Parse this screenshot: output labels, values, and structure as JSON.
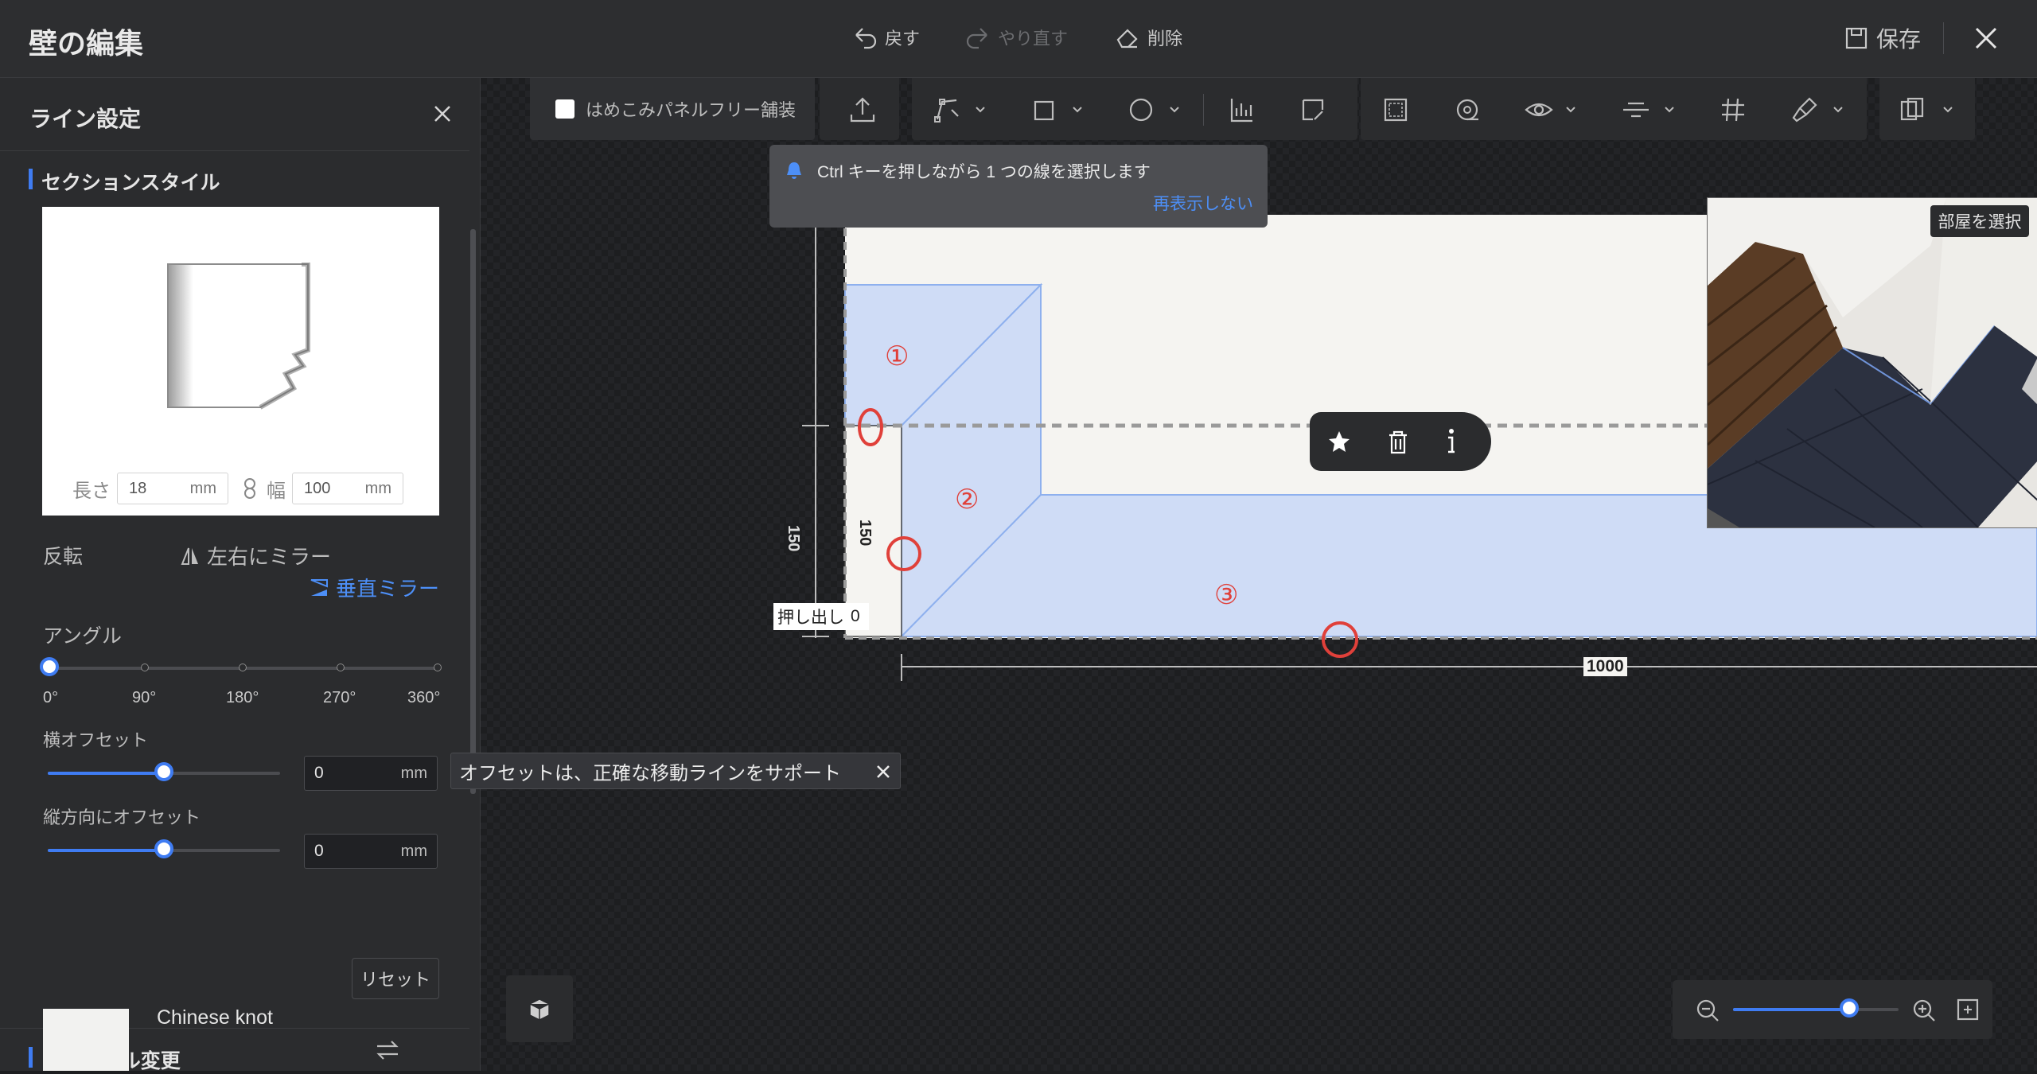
{
  "app": {
    "title": "壁の編集"
  },
  "top_actions": {
    "undo": "戻す",
    "redo": "やり直す",
    "delete": "削除",
    "save": "保存"
  },
  "panel": {
    "title": "ライン設定",
    "section_style": "セクションスタイル",
    "length_label": "長さ",
    "length_value": "18",
    "length_unit": "mm",
    "width_label": "幅",
    "width_value": "100",
    "width_unit": "mm",
    "flip_label": "反転",
    "mirror_h": "左右にミラー",
    "mirror_v": "垂直ミラー",
    "angle_label": "アングル",
    "angle_ticks": [
      "0°",
      "90°",
      "180°",
      "270°",
      "360°"
    ],
    "angle_value": 0,
    "h_offset_label": "横オフセット",
    "h_offset_value": "0",
    "h_offset_unit": "mm",
    "h_offset_level": 0.5,
    "v_offset_label": "縦方向にオフセット",
    "v_offset_value": "0",
    "v_offset_unit": "mm",
    "v_offset_level": 0.5,
    "reset": "リセット",
    "material_section": "マテリアル変更",
    "material_name": "Chinese knot"
  },
  "toolbar": {
    "seamless_label": "はめこみパネルフリー舗装",
    "seamless_checked": false
  },
  "notice": {
    "text": "Ctrl キーを押しながら 1 つの線を選択します",
    "link": "再表示しない"
  },
  "canvas": {
    "markers": [
      "①",
      "②",
      "③"
    ],
    "dim_vertical_left": "150",
    "dim_vertical_inner": "150",
    "dim_horizontal": "1000",
    "extrude_label": "押し出し",
    "extrude_value": "0"
  },
  "preview3d": {
    "select_room": "部屋を選択"
  },
  "offset_tip": {
    "text": "オフセットは、正確な移動ラインをサポート"
  },
  "zoom": {
    "level": 0.7
  },
  "colors": {
    "accent": "#3f7cf2",
    "marker_red": "#e0403a",
    "panel_fill": "#cfdcf6"
  }
}
